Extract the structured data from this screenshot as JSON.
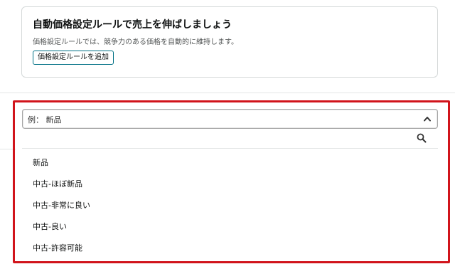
{
  "promo": {
    "title": "自動価格設定ルールで売上を伸ばしましょう",
    "description": "価格設定ルールでは、競争力のある価格を自動的に維持します。",
    "button_label": "価格設定ルールを追加"
  },
  "condition_select": {
    "selected_value": "例： 新品",
    "search_value": "",
    "options": [
      {
        "label": "新品"
      },
      {
        "label": "中古-ほぼ新品"
      },
      {
        "label": "中古-非常に良い"
      },
      {
        "label": "中古-良い"
      },
      {
        "label": "中古-許容可能"
      }
    ]
  },
  "icons": {
    "chevron": "chevron-up-icon",
    "search": "search-icon"
  },
  "colors": {
    "highlight": "#d1141b",
    "button_border": "#007185"
  }
}
